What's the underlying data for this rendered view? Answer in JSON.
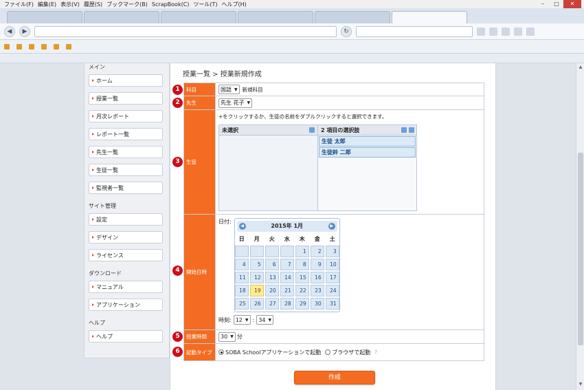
{
  "browser": {
    "menu": [
      "ファイル(F)",
      "編集(E)",
      "表示(V)",
      "履歴(S)",
      "ブックマーク(B)",
      "ScrapBook(C)",
      "ツール(T)",
      "ヘルプ(H)"
    ],
    "tabs": [
      "",
      "",
      "",
      "",
      "",
      ""
    ],
    "url": "",
    "search": ""
  },
  "sidebar": {
    "section_main": "メイン",
    "main_items": [
      "ホーム",
      "授業一覧",
      "月次レポート",
      "レポート一覧",
      "先生一覧",
      "生徒一覧",
      "監視者一覧"
    ],
    "section_site": "サイト管理",
    "site_items": [
      "設定",
      "デザイン",
      "ライセンス"
    ],
    "section_download": "ダウンロード",
    "download_items": [
      "マニュアル",
      "アプリケーション"
    ],
    "section_help": "ヘルプ",
    "help_items": [
      "ヘルプ"
    ]
  },
  "breadcrumb": "授業一覧 > 授業新規作成",
  "form": {
    "subject": {
      "label": "科目",
      "value": "国語",
      "link": "新規科目",
      "badge": "1"
    },
    "teacher": {
      "label": "先生",
      "value": "先生 花子",
      "badge": "2"
    },
    "students": {
      "label": "生徒",
      "badge": "3",
      "hint": "+をクリックするか、生徒の名前をダブルクリックすると選択できます。",
      "unselected_header": "未選択",
      "selected_header": "2 項目の選択肢",
      "selected": [
        "生徒 太郎",
        "生徒鈴 二郎"
      ]
    },
    "start": {
      "label": "開始日時",
      "badge": "4",
      "date_label": "日付:",
      "calendar_title": "2015年 1月",
      "weekdays": [
        "日",
        "月",
        "火",
        "水",
        "木",
        "金",
        "土"
      ],
      "days": [
        "",
        "",
        "",
        "",
        "1",
        "2",
        "3",
        "4",
        "5",
        "6",
        "7",
        "8",
        "9",
        "10",
        "11",
        "12",
        "13",
        "14",
        "15",
        "16",
        "17",
        "18",
        "19",
        "20",
        "21",
        "22",
        "23",
        "24",
        "25",
        "26",
        "27",
        "28",
        "29",
        "30",
        "31"
      ],
      "selected_day": "19",
      "time_label": "時刻:",
      "hour": "12",
      "minute": "34",
      "sep": ":"
    },
    "duration": {
      "label": "授業時間",
      "badge": "5",
      "value": "30",
      "unit": "分"
    },
    "launch": {
      "label": "起動タイプ",
      "badge": "6",
      "option_app": "SOBA Schoolアプリケーションで起動",
      "option_browser": "ブラウザで起動",
      "help": "?"
    }
  },
  "submit_label": "作成",
  "colors": {
    "accent": "#f36c21",
    "badge": "#cc0c1a"
  }
}
